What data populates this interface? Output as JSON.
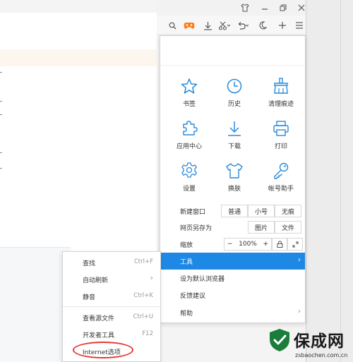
{
  "toolbar": {
    "icons": [
      "search-icon",
      "game-icon",
      "download-icon",
      "scissors-icon",
      "undo-icon",
      "moon-icon",
      "plus-icon",
      "menu-icon"
    ],
    "accent": "#ff7a1a"
  },
  "window_controls": [
    "shirt-icon",
    "minimize-icon",
    "restore-icon",
    "close-icon"
  ],
  "main_menu": {
    "grid": [
      {
        "label": "书签",
        "icon": "star-icon"
      },
      {
        "label": "历史",
        "icon": "clock-icon"
      },
      {
        "label": "清理痕迹",
        "icon": "broom-icon"
      },
      {
        "label": "应用中心",
        "icon": "puzzle-icon"
      },
      {
        "label": "下载",
        "icon": "download-arrow-icon"
      },
      {
        "label": "打印",
        "icon": "printer-icon"
      },
      {
        "label": "设置",
        "icon": "gear-icon"
      },
      {
        "label": "换肤",
        "icon": "tshirt-icon"
      },
      {
        "label": "帐号助手",
        "icon": "key-icon"
      }
    ],
    "new_window": {
      "label": "新建窗口",
      "options": [
        "普通",
        "小号",
        "无痕"
      ]
    },
    "save_as": {
      "label": "网页另存为",
      "options": [
        "图片",
        "文件"
      ]
    },
    "zoom": {
      "label": "缩放",
      "minus": "−",
      "value": "100%",
      "plus": "+"
    },
    "items": [
      {
        "label": "工具",
        "active": true,
        "arrow": "›"
      },
      {
        "label": "设为默认浏览器"
      },
      {
        "label": "反馈建议"
      },
      {
        "label": "帮助",
        "arrow": "›"
      }
    ],
    "active_color": "#1e88e5",
    "icon_color": "#2a8bdc"
  },
  "submenu": {
    "items": [
      {
        "label": "查找",
        "shortcut": "Ctrl+F"
      },
      {
        "label": "自动刷新",
        "shortcut": "›"
      },
      {
        "label": "静音",
        "shortcut": "Ctrl+K"
      },
      {
        "label": "查看源文件",
        "shortcut": "Ctrl+U"
      },
      {
        "label": "开发者工具",
        "shortcut": "F12"
      },
      {
        "label": "Internet选项",
        "shortcut": ""
      }
    ],
    "highlight_color": "#e53935"
  },
  "watermark": {
    "title": "保成网",
    "url": "zsbaochen.com.cn"
  }
}
